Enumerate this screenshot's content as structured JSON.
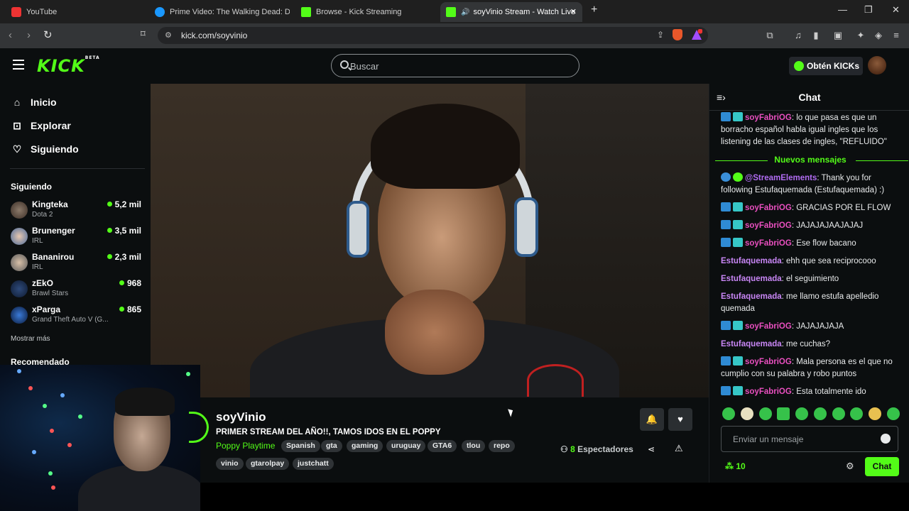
{
  "browser": {
    "tabs": [
      {
        "label": "YouTube",
        "active": false
      },
      {
        "label": "Prime Video: The Walking Dead: Dead",
        "active": false
      },
      {
        "label": "Browse - Kick Streaming",
        "active": false
      },
      {
        "label": "soyVinio Stream - Watch Live",
        "active": true
      }
    ],
    "new_tab": "+",
    "url": "kick.com/soyvinio",
    "window_controls": {
      "minimize": "—",
      "maximize": "❐",
      "close": "✕"
    },
    "tab_close": "✕"
  },
  "header": {
    "logo": "KICK",
    "logo_badge": "BETA",
    "search_placeholder": "Buscar",
    "get_kicks": "Obtén KICKs"
  },
  "sidebar": {
    "nav": [
      {
        "label": "Inicio",
        "icon": "home-icon"
      },
      {
        "label": "Explorar",
        "icon": "compass-icon"
      },
      {
        "label": "Siguiendo",
        "icon": "heart-icon"
      }
    ],
    "following_title": "Siguiendo",
    "channels": [
      {
        "name": "Kingteka",
        "game": "Dota 2",
        "viewers": "5,2 mil"
      },
      {
        "name": "Brunenger",
        "game": "IRL",
        "viewers": "3,5 mil"
      },
      {
        "name": "Bananirou",
        "game": "IRL",
        "viewers": "2,3 mil"
      },
      {
        "name": "zEkO",
        "game": "Brawl Stars",
        "viewers": "968"
      },
      {
        "name": "xParga",
        "game": "Grand Theft Auto V (G...",
        "viewers": "865"
      }
    ],
    "show_more": "Mostrar más",
    "recommended_title": "Recomendado"
  },
  "stream": {
    "streamer": "soyVinio",
    "title": "PRIMER STREAM DEL AÑO!!, TAMOS IDOS EN EL POPPY",
    "category": "Poppy Playtime",
    "tags": [
      "Spanish",
      "gta",
      "gaming",
      "uruguay",
      "GTA6",
      "tlou",
      "repo",
      "vinio",
      "gtarolpay",
      "justchatt"
    ],
    "viewers_count": "8",
    "viewers_label": "Espectadores"
  },
  "chat": {
    "title": "Chat",
    "new_messages": "Nuevos mensajes",
    "messages": [
      {
        "user": "soyFabriOG",
        "text": "lo que pasa es que un borracho español habla igual ingles que los listening de las clases de ingles, \"REFLUIDO\"",
        "color": "#e94fbf",
        "badges": true
      },
      {
        "user": "@StreamElements",
        "text": "Thank you for following Estufaquemada (Estufaquemada) :)",
        "color": "#b16cf2",
        "badges": true,
        "bot": true
      },
      {
        "user": "soyFabriOG",
        "text": "GRACIAS POR EL FLOW",
        "color": "#e94fbf",
        "badges": true
      },
      {
        "user": "soyFabriOG",
        "text": "JAJAJAJAAJAJAJ",
        "color": "#e94fbf",
        "badges": true
      },
      {
        "user": "soyFabriOG",
        "text": "Ese flow bacano",
        "color": "#e94fbf",
        "badges": true
      },
      {
        "user": "Estufaquemada",
        "text": "ehh que sea reciprocooo",
        "color": "#c886f5",
        "badges": false
      },
      {
        "user": "Estufaquemada",
        "text": "el seguimiento",
        "color": "#c886f5",
        "badges": false
      },
      {
        "user": "Estufaquemada",
        "text": "me llamo estufa apelledio quemada",
        "color": "#c886f5",
        "badges": false
      },
      {
        "user": "soyFabriOG",
        "text": "JAJAJAJAJA",
        "color": "#e94fbf",
        "badges": true
      },
      {
        "user": "Estufaquemada",
        "text": "me cuchas?",
        "color": "#c886f5",
        "badges": false
      },
      {
        "user": "soyFabriOG",
        "text": "Mala persona es el que no cumplio con su palabra y robo puntos",
        "color": "#e94fbf",
        "badges": true
      },
      {
        "user": "soyFabriOG",
        "text": "Esta totalmente ido",
        "color": "#e94fbf",
        "badges": true
      }
    ],
    "input_placeholder": "Enviar un mensaje",
    "points": "10",
    "send_label": "Chat",
    "accent": "#53fc18"
  }
}
